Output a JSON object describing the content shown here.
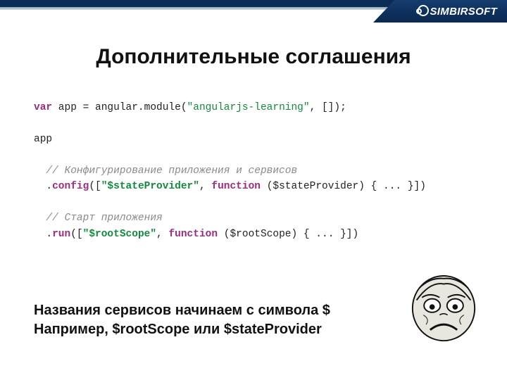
{
  "brand": "SIMBIRSOFT",
  "title": "Дополнительные соглашения",
  "code": {
    "l1_kw": "var",
    "l1_a": " app = angular.module(",
    "l1_str": "\"angularjs-learning\"",
    "l1_b": ", []);",
    "l3": "app",
    "l5_cmt": "  // Конфигурирование приложения и сервисов",
    "l6_a": "  .",
    "l6_meth": "config",
    "l6_b": "([",
    "l6_str": "\"$stateProvider\"",
    "l6_c": ", ",
    "l6_kw": "function",
    "l6_d": " ($stateProvider) { ... }])",
    "l8_cmt": "  // Старт приложения",
    "l9_a": "  .",
    "l9_meth": "run",
    "l9_b": "([",
    "l9_str": "\"$rootScope\"",
    "l9_c": ", ",
    "l9_kw": "function",
    "l9_d": " ($rootScope) { ... }])"
  },
  "footer": {
    "line1": "Названия сервисов начинаем с символа $",
    "line2": "Например, $rootScope или $stateProvider"
  }
}
